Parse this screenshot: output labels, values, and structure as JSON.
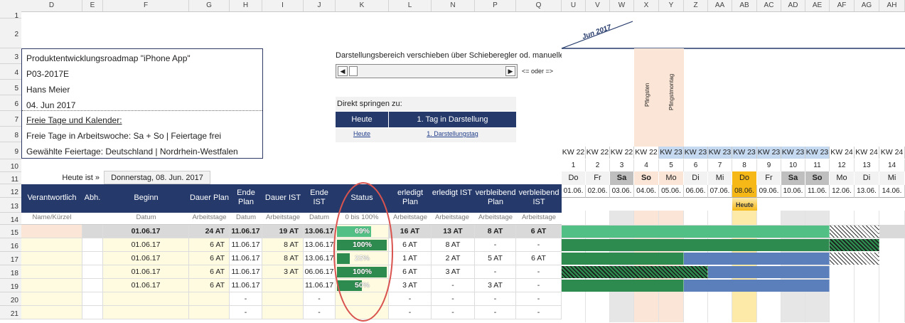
{
  "columns": [
    "D",
    "E",
    "F",
    "G",
    "H",
    "I",
    "J",
    "K",
    "L",
    "N",
    "P",
    "Q",
    "U",
    "V",
    "W",
    "X",
    "Y",
    "Z",
    "AA",
    "AB",
    "AC",
    "AD",
    "AE",
    "AF",
    "AG",
    "AH"
  ],
  "rows": [
    "1",
    "2",
    "3",
    "4",
    "5",
    "6",
    "7",
    "8",
    "9",
    "10",
    "11",
    "12",
    "13",
    "14",
    "15",
    "16",
    "17",
    "18",
    "19",
    "20",
    "21"
  ],
  "info": {
    "title": "Produktentwicklungsroadmap \"iPhone App\"",
    "code": "P03-2017E",
    "person": "Hans Meier",
    "date": "04. Jun 2017",
    "link": "Freie Tage und Kalender:",
    "free_days": "Freie Tage in Arbeitswoche: Sa + So | Feiertage frei",
    "holidays": "Gewählte Feiertage: Deutschland | Nordrhein-Westfalen"
  },
  "scroll": {
    "label": "Darstellungsbereich verschieben über Schieberegler od. manuelle E",
    "hint": "<= oder =>",
    "jump_label": "Direkt springen zu:",
    "today_btn": "Heute",
    "first_btn": "1. Tag in Darstellung",
    "today_link": "Heute",
    "first_link": "1. Darstellungstag"
  },
  "today": {
    "label": "Heute ist »",
    "value": "Donnerstag, 08. Jun. 2017"
  },
  "headers": {
    "verantwortlich": "Verantwortlich",
    "abh": "Abh.",
    "beginn": "Beginn",
    "dauer_plan": "Dauer Plan",
    "ende_plan": "Ende Plan",
    "dauer_ist": "Dauer IST",
    "ende_ist": "Ende IST",
    "status": "Status",
    "erledigt_plan": "erledigt Plan",
    "erledigt_ist": "erledigt IST",
    "verbleibend_plan": "verbleibend Plan",
    "verbleibend_ist": "verbleibend IST"
  },
  "subheaders": {
    "name": "Name/Kürzel",
    "datum1": "Datum",
    "arbeitstage1": "Arbeitstage",
    "datum2": "Datum",
    "arbeitstage2": "Arbeitstage",
    "datum3": "Datum",
    "status": "0 bis 100%",
    "arbeitstage3": "Arbeitstage",
    "arbeitstage4": "Arbeitstage",
    "arbeitstage5": "Arbeitstage",
    "arbeitstage6": "Arbeitstage"
  },
  "calendar": {
    "month": "Jun 2017",
    "holiday1": "Pfingsten",
    "holiday2": "Pfingstmontag",
    "today_marker": "Heute",
    "kw": [
      "KW 22",
      "KW 22",
      "KW 22",
      "KW 22",
      "KW 23",
      "KW 23",
      "KW 23",
      "KW 23",
      "KW 23",
      "KW 23",
      "KW 23",
      "KW 24",
      "KW 24",
      "KW 24"
    ],
    "day_num": [
      "1",
      "2",
      "3",
      "4",
      "5",
      "6",
      "7",
      "8",
      "9",
      "10",
      "11",
      "12",
      "13",
      "14"
    ],
    "weekday": [
      "Do",
      "Fr",
      "Sa",
      "So",
      "Mo",
      "Di",
      "Mi",
      "Do",
      "Fr",
      "Sa",
      "So",
      "Mo",
      "Di",
      "Mi"
    ],
    "dates": [
      "01.06.",
      "02.06.",
      "03.06.",
      "04.06.",
      "05.06.",
      "06.06.",
      "07.06.",
      "08.06.",
      "09.06.",
      "10.06.",
      "11.06.",
      "12.06.",
      "13.06.",
      "14.06."
    ]
  },
  "tasks": [
    {
      "beginn": "01.06.17",
      "dauer_plan": "24 AT",
      "ende_plan": "11.06.17",
      "dauer_ist": "19 AT",
      "ende_ist": "13.06.17",
      "status": "69%",
      "pct": 69,
      "erl_plan": "16 AT",
      "erl_ist": "13 AT",
      "verb_plan": "8 AT",
      "verb_ist": "6 AT"
    },
    {
      "beginn": "01.06.17",
      "dauer_plan": "6 AT",
      "ende_plan": "11.06.17",
      "dauer_ist": "8 AT",
      "ende_ist": "13.06.17",
      "status": "100%",
      "pct": 100,
      "erl_plan": "6 AT",
      "erl_ist": "8 AT",
      "verb_plan": "-",
      "verb_ist": "-"
    },
    {
      "beginn": "01.06.17",
      "dauer_plan": "6 AT",
      "ende_plan": "11.06.17",
      "dauer_ist": "8 AT",
      "ende_ist": "13.06.17",
      "status": "25%",
      "pct": 25,
      "erl_plan": "1 AT",
      "erl_ist": "2 AT",
      "verb_plan": "5 AT",
      "verb_ist": "6 AT"
    },
    {
      "beginn": "01.06.17",
      "dauer_plan": "6 AT",
      "ende_plan": "11.06.17",
      "dauer_ist": "3 AT",
      "ende_ist": "06.06.17",
      "status": "100%",
      "pct": 100,
      "erl_plan": "6 AT",
      "erl_ist": "3 AT",
      "verb_plan": "-",
      "verb_ist": "-"
    },
    {
      "beginn": "01.06.17",
      "dauer_plan": "6 AT",
      "ende_plan": "11.06.17",
      "dauer_ist": "",
      "ende_ist": "11.06.17",
      "status": "50%",
      "pct": 50,
      "erl_plan": "3 AT",
      "erl_ist": "-",
      "verb_plan": "3 AT",
      "verb_ist": "-"
    },
    {
      "beginn": "",
      "dauer_plan": "",
      "ende_plan": "-",
      "dauer_ist": "",
      "ende_ist": "-",
      "status": "",
      "pct": 0,
      "erl_plan": "-",
      "erl_ist": "-",
      "verb_plan": "-",
      "verb_ist": "-"
    },
    {
      "beginn": "",
      "dauer_plan": "",
      "ende_plan": "-",
      "dauer_ist": "",
      "ende_ist": "-",
      "status": "",
      "pct": 0,
      "erl_plan": "-",
      "erl_ist": "-",
      "verb_plan": "-",
      "verb_ist": "-"
    }
  ],
  "colors": {
    "navy": "#253a6b",
    "green": "#2e8b4f",
    "light_green": "#52c085",
    "blue": "#5b7fba",
    "yellow_row": "#fffbe0",
    "today": "#f5b817",
    "holiday": "#fbe5d6"
  }
}
